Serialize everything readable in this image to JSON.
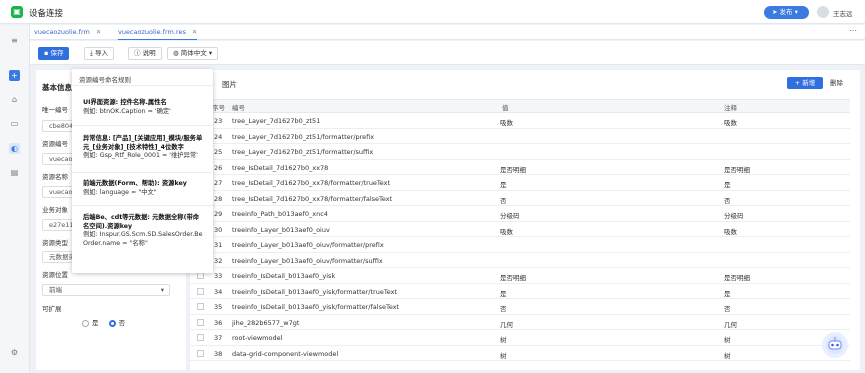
{
  "app": {
    "title": "设备连接",
    "publish": "发布",
    "user": "王志远"
  },
  "tabs": [
    {
      "label": "vuecaozuolie.frm",
      "close": "✕"
    },
    {
      "label": "vuecaozuolie.frm.res",
      "close": "✕"
    }
  ],
  "toolbar": {
    "save": "保存",
    "import": "导入",
    "help": "说明",
    "language": "简体中文"
  },
  "left": {
    "title": "基本信息",
    "fields": [
      {
        "label": "唯一编号",
        "value": "cbe8042"
      },
      {
        "label": "资源编号",
        "value": "vuecaoz"
      },
      {
        "label": "资源名称",
        "value": "vuecaoz"
      },
      {
        "label": "业务对象",
        "value": "e27e117"
      },
      {
        "label": "资源类型",
        "value": "元数据资"
      },
      {
        "label": "资源位置",
        "value": "前端"
      }
    ],
    "extensible": {
      "label": "可扩展",
      "yes": "是",
      "no": "否"
    }
  },
  "tooltip": {
    "title": "资源编号命名规则",
    "blocks": [
      {
        "head": "UI界面资源: 控件名称.属性名",
        "body": "例如: btnOK.Caption = '确定'"
      },
      {
        "head": "异常信息: [产品]_[关键应用]_模块/服务单元_[业务对象]_[技术特性]_4位数字",
        "body": "例如: Gsp_Rtf_Role_0001 = '维护异常'"
      },
      {
        "head": "前端元数据(Form、帮助): 资源key",
        "body": "例如: language = \"中文\""
      },
      {
        "head": "后端Be、cdt等元数据: 元数据全称(带命名空间).资源key",
        "body": "例如: Inspur.GS.Scm.SD.SalesOrder.BeOrder.name = \"名称\""
      }
    ]
  },
  "main": {
    "title": "图片",
    "add": "+ 新增",
    "delete": "删除",
    "columns": [
      "序号",
      "编号",
      "值",
      "注释"
    ],
    "rows": [
      {
        "no": "23",
        "code": "tree_Layer_7d1627b0_zt51",
        "value": "吸数",
        "note": "吸数"
      },
      {
        "no": "24",
        "code": "tree_Layer_7d1627b0_zt51/formatter/prefix",
        "value": "",
        "note": ""
      },
      {
        "no": "25",
        "code": "tree_Layer_7d1627b0_zt51/formatter/suffix",
        "value": "",
        "note": ""
      },
      {
        "no": "26",
        "code": "tree_IsDetail_7d1627b0_xx78",
        "value": "是否明细",
        "note": "是否明细"
      },
      {
        "no": "27",
        "code": "tree_IsDetail_7d1627b0_xx78/formatter/trueText",
        "value": "是",
        "note": "是"
      },
      {
        "no": "28",
        "code": "tree_IsDetail_7d1627b0_xx78/formatter/falseText",
        "value": "否",
        "note": "否"
      },
      {
        "no": "29",
        "code": "treeinfo_Path_b013aef0_xnc4",
        "value": "分级码",
        "note": "分级码"
      },
      {
        "no": "30",
        "code": "treeinfo_Layer_b013aef0_oiuv",
        "value": "吸数",
        "note": "吸数"
      },
      {
        "no": "31",
        "code": "treeinfo_Layer_b013aef0_oiuv/formatter/prefix",
        "value": "",
        "note": ""
      },
      {
        "no": "32",
        "code": "treeinfo_Layer_b013aef0_oiuv/formatter/suffix",
        "value": "",
        "note": ""
      },
      {
        "no": "33",
        "code": "treeinfo_IsDetail_b013aef0_yisk",
        "value": "是否明细",
        "note": "是否明细"
      },
      {
        "no": "34",
        "code": "treeinfo_IsDetail_b013aef0_yisk/formatter/trueText",
        "value": "是",
        "note": "是"
      },
      {
        "no": "35",
        "code": "treeinfo_IsDetail_b013aef0_yisk/formatter/falseText",
        "value": "否",
        "note": "否"
      },
      {
        "no": "36",
        "code": "jihe_282b6577_w7gt",
        "value": "几何",
        "note": "几何"
      },
      {
        "no": "37",
        "code": "root-viewmodel",
        "value": "树",
        "note": "树"
      },
      {
        "no": "38",
        "code": "data-grid-component-viewmodel",
        "value": "树",
        "note": "树"
      }
    ]
  }
}
